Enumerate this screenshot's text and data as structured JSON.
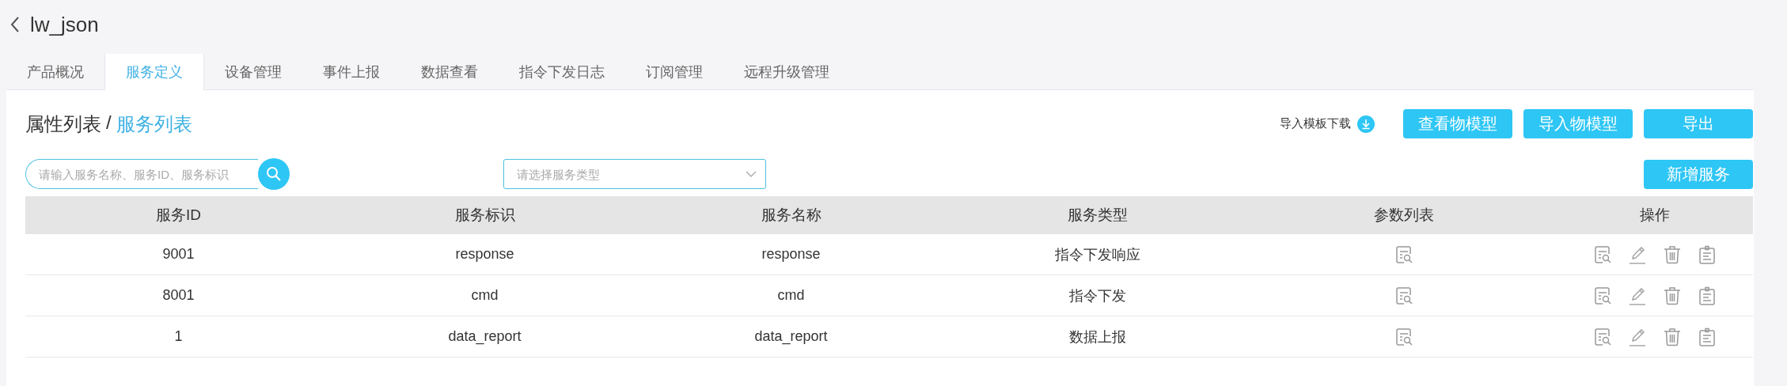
{
  "header": {
    "title": "lw_json"
  },
  "tabs": [
    {
      "label": "产品概况",
      "selected": false
    },
    {
      "label": "服务定义",
      "selected": true
    },
    {
      "label": "设备管理",
      "selected": false
    },
    {
      "label": "事件上报",
      "selected": false
    },
    {
      "label": "数据查看",
      "selected": false
    },
    {
      "label": "指令下发日志",
      "selected": false
    },
    {
      "label": "订阅管理",
      "selected": false
    },
    {
      "label": "远程升级管理",
      "selected": false
    }
  ],
  "breadcrumb": {
    "parent": "属性列表",
    "separator": "/",
    "current": "服务列表"
  },
  "template_download": "导入模板下载",
  "buttons": [
    "查看物模型",
    "导入物模型",
    "导出"
  ],
  "search": {
    "placeholder": "请输入服务名称、服务ID、服务标识"
  },
  "type_select": {
    "placeholder": "请选择服务类型"
  },
  "add_button": "新增服务",
  "table": {
    "columns": [
      "服务ID",
      "服务标识",
      "服务名称",
      "服务类型",
      "参数列表",
      "操作"
    ],
    "rows": [
      {
        "id": "9001",
        "identifier": "response",
        "name": "response",
        "type": "指令下发响应"
      },
      {
        "id": "8001",
        "identifier": "cmd",
        "name": "cmd",
        "type": "指令下发"
      },
      {
        "id": "1",
        "identifier": "data_report",
        "name": "data_report",
        "type": "数据上报"
      }
    ]
  }
}
